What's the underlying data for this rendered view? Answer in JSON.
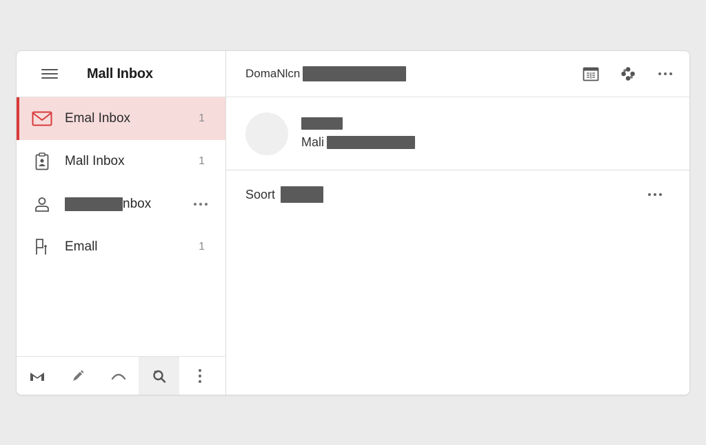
{
  "sidebar": {
    "title": "Mall Inbox",
    "items": [
      {
        "label": "Emal Inbox",
        "count": "1",
        "icon": "mail-icon",
        "active": true
      },
      {
        "label": "Mall Inbox",
        "count": "1",
        "icon": "clipboard-user-icon"
      },
      {
        "label_suffix": "nbox",
        "icon": "user-icon",
        "has_more": true
      },
      {
        "label": "Emall",
        "count": "1",
        "icon": "document-icon"
      }
    ],
    "footer": [
      "gmail-logo-icon",
      "pen-icon",
      "arc-icon",
      "search-icon",
      "more-vertical-icon"
    ]
  },
  "main": {
    "header_title": "DomaNlcn",
    "actions": [
      "calendar-icon",
      "flower-icon",
      "more-horizontal-icon"
    ],
    "preview": {
      "subject_prefix": "Mali"
    },
    "sort_label": "Soort"
  },
  "colors": {
    "accent": "#d93a3a",
    "active_bg": "#f7dcdc",
    "redaction": "#5a5a5a"
  }
}
